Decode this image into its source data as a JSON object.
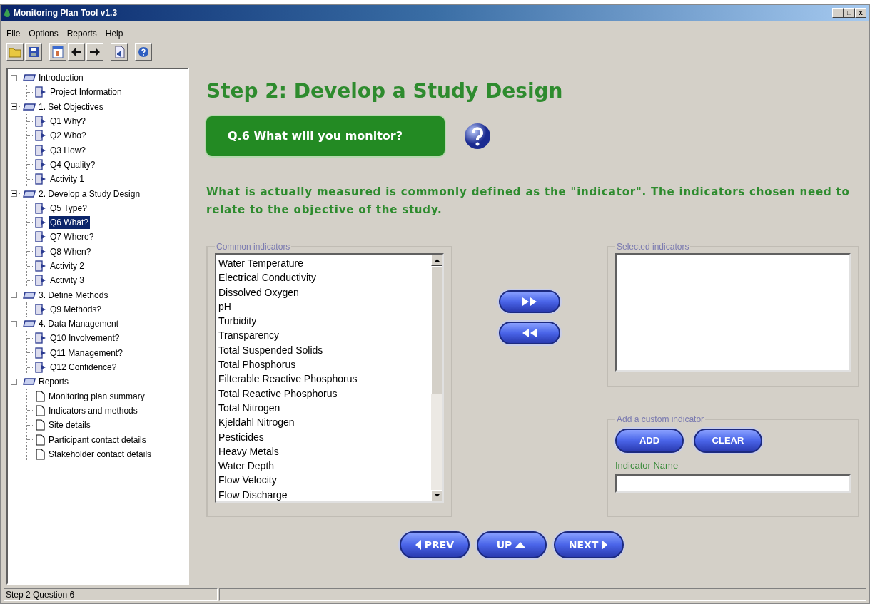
{
  "window": {
    "title": "Monitoring Plan Tool  v1.3",
    "controls": [
      "_",
      "□",
      "x"
    ]
  },
  "menu": [
    "File",
    "Options",
    "Reports",
    "Help"
  ],
  "toolbar": [
    {
      "kind": "open"
    },
    {
      "kind": "save"
    },
    {
      "kind": "form"
    },
    {
      "kind": "back"
    },
    {
      "kind": "forward"
    },
    {
      "kind": "audio"
    },
    {
      "kind": "help"
    }
  ],
  "tree": [
    {
      "label": "Introduction",
      "kind": "section",
      "expanded": true,
      "selected": false,
      "children": [
        {
          "label": "Project Information",
          "kind": "page",
          "selected": false
        }
      ]
    },
    {
      "label": "1. Set Objectives",
      "kind": "section",
      "expanded": true,
      "selected": false,
      "children": [
        {
          "label": "Q1 Why?",
          "kind": "page",
          "selected": false
        },
        {
          "label": "Q2 Who?",
          "kind": "page",
          "selected": false
        },
        {
          "label": "Q3 How?",
          "kind": "page",
          "selected": false
        },
        {
          "label": "Q4 Quality?",
          "kind": "page",
          "selected": false
        },
        {
          "label": "Activity 1",
          "kind": "page",
          "selected": false
        }
      ]
    },
    {
      "label": "2. Develop a Study Design",
      "kind": "section",
      "expanded": true,
      "selected": false,
      "children": [
        {
          "label": "Q5 Type?",
          "kind": "page",
          "selected": false
        },
        {
          "label": "Q6 What?",
          "kind": "page",
          "selected": true
        },
        {
          "label": "Q7 Where?",
          "kind": "page",
          "selected": false
        },
        {
          "label": "Q8 When?",
          "kind": "page",
          "selected": false
        },
        {
          "label": "Activity 2",
          "kind": "page",
          "selected": false
        },
        {
          "label": "Activity 3",
          "kind": "page",
          "selected": false
        }
      ]
    },
    {
      "label": "3. Define Methods",
      "kind": "section",
      "expanded": true,
      "selected": false,
      "children": [
        {
          "label": "Q9 Methods?",
          "kind": "page",
          "selected": false
        }
      ]
    },
    {
      "label": "4. Data Management",
      "kind": "section",
      "expanded": true,
      "selected": false,
      "children": [
        {
          "label": "Q10 Involvement?",
          "kind": "page",
          "selected": false
        },
        {
          "label": "Q11 Management?",
          "kind": "page",
          "selected": false
        },
        {
          "label": "Q12 Confidence?",
          "kind": "page",
          "selected": false
        }
      ]
    },
    {
      "label": "Reports",
      "kind": "section",
      "expanded": true,
      "selected": false,
      "children": [
        {
          "label": "Monitoring plan summary",
          "kind": "report",
          "selected": false
        },
        {
          "label": "Indicators and methods",
          "kind": "report",
          "selected": false
        },
        {
          "label": "Site details",
          "kind": "report",
          "selected": false
        },
        {
          "label": "Participant contact details",
          "kind": "report",
          "selected": false
        },
        {
          "label": "Stakeholder contact details",
          "kind": "report",
          "selected": false
        }
      ]
    }
  ],
  "main": {
    "heading": "Step 2: Develop a Study Design",
    "question": "Q.6 What will you monitor?",
    "description": "What is actually measured is commonly defined as the \"indicator\". The indicators chosen need to relate to the objective of the study.",
    "common": {
      "title": "Common indicators",
      "items": [
        {
          "label": "Water Temperature",
          "selected": false
        },
        {
          "label": "Electrical Conductivity",
          "selected": false
        },
        {
          "label": "Dissolved Oxygen",
          "selected": false
        },
        {
          "label": "pH",
          "selected": false
        },
        {
          "label": "Turbidity",
          "selected": false
        },
        {
          "label": "Transparency",
          "selected": false
        },
        {
          "label": "Total Suspended Solids",
          "selected": false
        },
        {
          "label": "Total Phosphorus",
          "selected": false
        },
        {
          "label": "Filterable Reactive Phosphorus",
          "selected": false
        },
        {
          "label": "Total Reactive Phosphorus",
          "selected": false
        },
        {
          "label": "Total Nitrogen",
          "selected": false
        },
        {
          "label": "Kjeldahl Nitrogen",
          "selected": false
        },
        {
          "label": "Pesticides",
          "selected": false
        },
        {
          "label": "Heavy Metals",
          "selected": false
        },
        {
          "label": "Water Depth",
          "selected": false
        },
        {
          "label": "Flow Velocity",
          "selected": false
        },
        {
          "label": "Flow Discharge",
          "selected": false
        }
      ]
    },
    "selected_title": "Selected indicators",
    "custom": {
      "title": "Add a custom indicator",
      "buttons": [
        "ADD",
        "CLEAR"
      ],
      "field_label": "Indicator Name"
    },
    "nav": [
      {
        "label": "PREV",
        "kind": "prev"
      },
      {
        "label": "UP",
        "kind": "up"
      },
      {
        "label": "NEXT",
        "kind": "next"
      }
    ]
  },
  "status_bar": "Step 2 Question 6"
}
